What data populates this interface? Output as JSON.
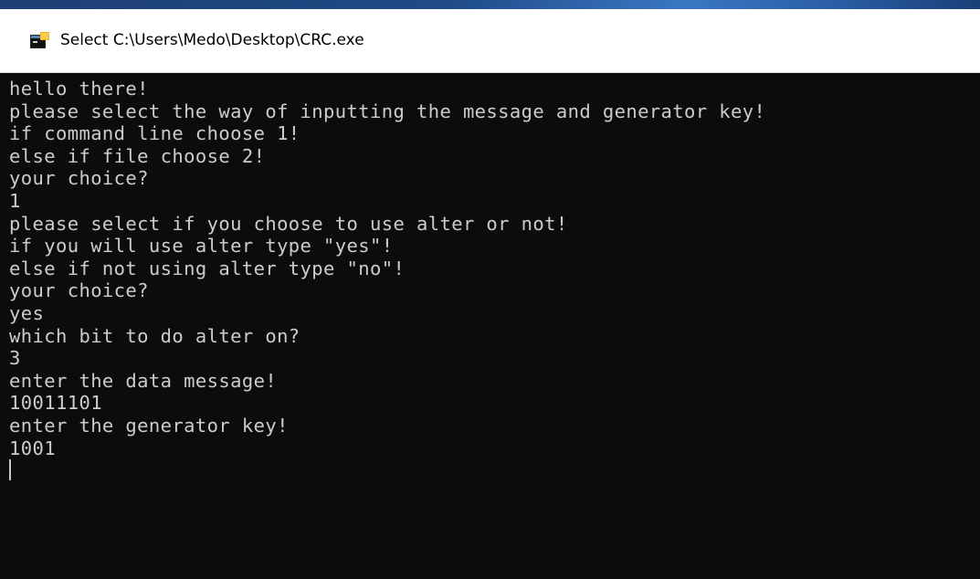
{
  "window": {
    "title": "Select C:\\Users\\Medo\\Desktop\\CRC.exe",
    "icon": "console-app-icon"
  },
  "console": {
    "lines": [
      "hello there!",
      "please select the way of inputting the message and generator key!",
      "if command line choose 1!",
      "else if file choose 2!",
      "your choice?",
      "1",
      "please select if you choose to use alter or not!",
      "if you will use alter type \"yes\"!",
      "else if not using alter type \"no\"!",
      "your choice?",
      "yes",
      "which bit to do alter on?",
      "3",
      "enter the data message!",
      "10011101",
      "enter the generator key!",
      "1001"
    ]
  },
  "colors": {
    "console_background": "#0c0c0c",
    "console_text": "#cccccc",
    "titlebar_background": "#ffffff"
  }
}
